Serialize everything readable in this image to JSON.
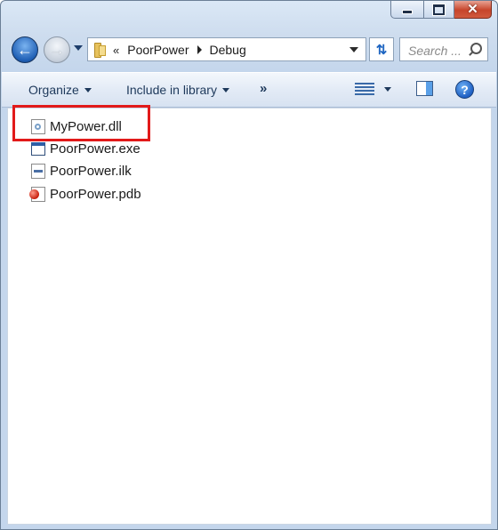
{
  "window": {
    "caption_buttons": {
      "minimize": "minimize",
      "maximize": "maximize",
      "close": "✕"
    }
  },
  "address_bar": {
    "overflow_chevron": "«",
    "segments": [
      "PoorPower",
      "Debug"
    ]
  },
  "search": {
    "placeholder": "Search ..."
  },
  "toolbar": {
    "organize_label": "Organize",
    "include_label": "Include in library",
    "more_label": "»",
    "help_label": "?"
  },
  "files": [
    {
      "name": "MyPower.dll",
      "icon": "dll-file-icon",
      "highlighted": true
    },
    {
      "name": "PoorPower.exe",
      "icon": "exe-file-icon"
    },
    {
      "name": "PoorPower.ilk",
      "icon": "ilk-file-icon"
    },
    {
      "name": "PoorPower.pdb",
      "icon": "pdb-file-icon"
    }
  ],
  "colors": {
    "highlight": "#e21a1a",
    "link": "#1e395b"
  }
}
